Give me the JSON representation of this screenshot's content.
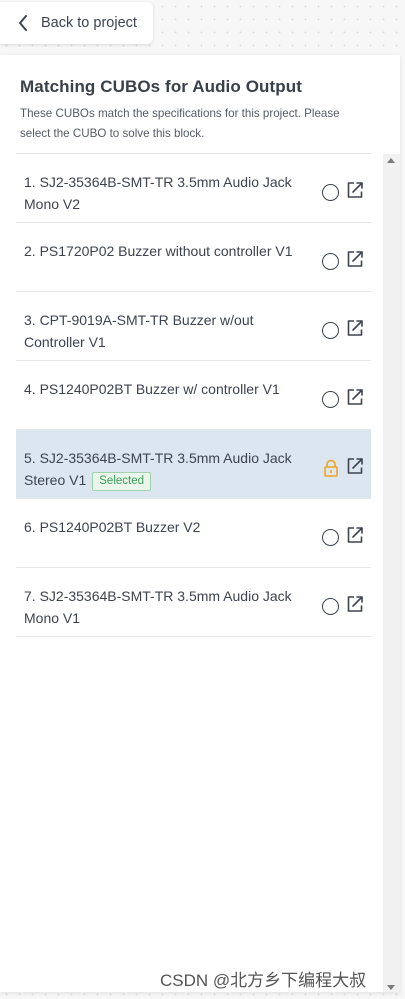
{
  "back": {
    "label": "Back to project"
  },
  "panel": {
    "title": "Matching CUBOs for Audio Output",
    "subtitle": "These CUBOs match the specifications for this project. Please select the CUBO to solve this block."
  },
  "items": [
    {
      "label": "1. SJ2-35364B-SMT-TR 3.5mm Audio Jack Mono V2",
      "selected": false,
      "badge": ""
    },
    {
      "label": "2. PS1720P02 Buzzer without controller V1",
      "selected": false,
      "badge": ""
    },
    {
      "label": "3. CPT-9019A-SMT-TR Buzzer w/out Controller V1",
      "selected": false,
      "badge": ""
    },
    {
      "label": "4. PS1240P02BT Buzzer w/ controller V1",
      "selected": false,
      "badge": ""
    },
    {
      "label": "5. SJ2-35364B-SMT-TR 3.5mm Audio Jack Stereo V1",
      "selected": true,
      "badge": "Selected"
    },
    {
      "label": "6. PS1240P02BT Buzzer V2",
      "selected": false,
      "badge": ""
    },
    {
      "label": "7. SJ2-35364B-SMT-TR 3.5mm Audio Jack Mono V1",
      "selected": false,
      "badge": ""
    }
  ],
  "icons": {
    "radio": "radio-circle-icon",
    "lock": "lock-icon",
    "open": "external-link-icon",
    "back": "chevron-left-icon"
  },
  "colors": {
    "selected_bg": "#dbe6f1",
    "lock": "#f0a21c",
    "badge_text": "#3b9b56",
    "badge_border": "#9fd3ad"
  },
  "watermark": "CSDN @北方乡下编程大叔"
}
